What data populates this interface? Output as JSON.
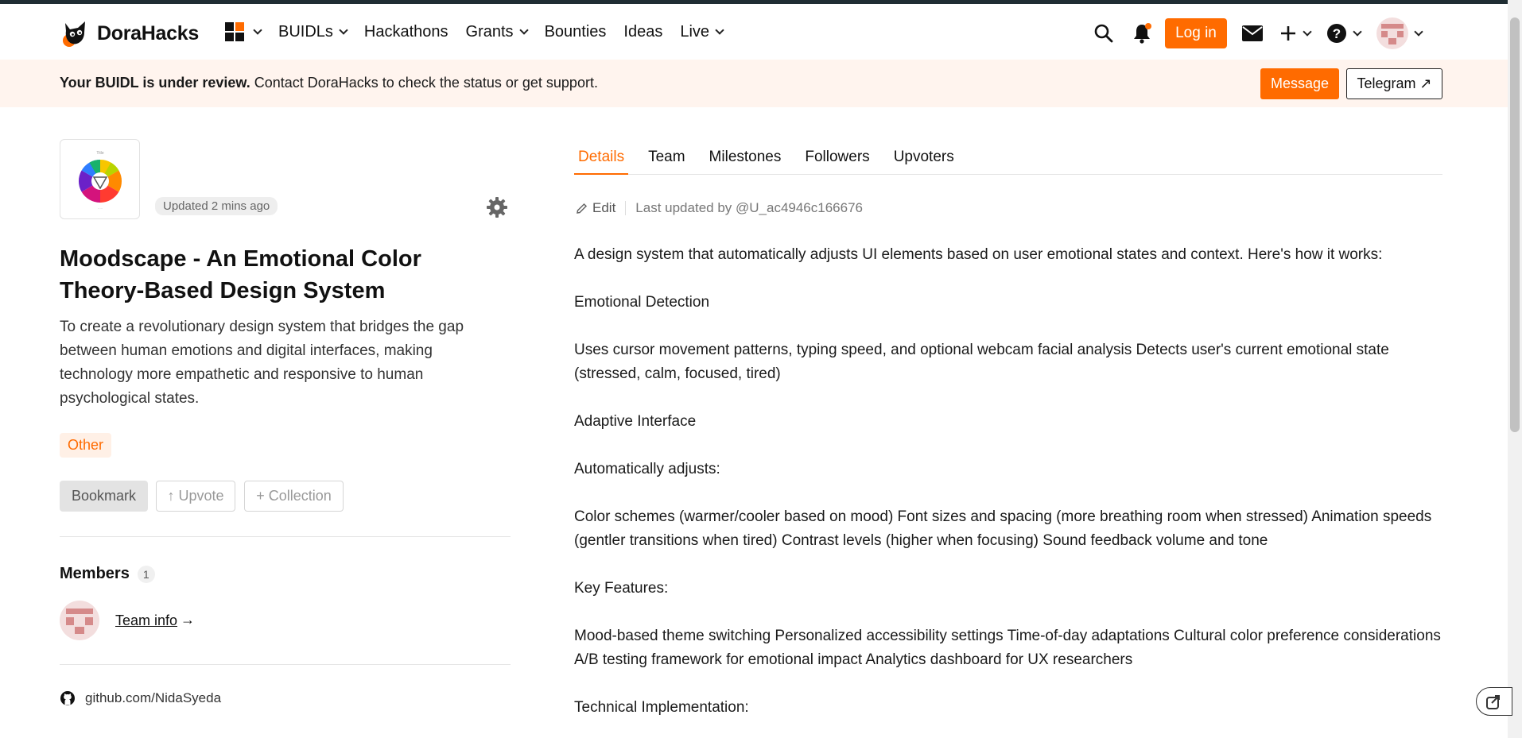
{
  "brand": {
    "name": "DoraHacks",
    "accent": "#ff6b00"
  },
  "nav": {
    "items": [
      {
        "label": "BUIDLs",
        "dropdown": true
      },
      {
        "label": "Hackathons",
        "dropdown": false
      },
      {
        "label": "Grants",
        "dropdown": true
      },
      {
        "label": "Bounties",
        "dropdown": false
      },
      {
        "label": "Ideas",
        "dropdown": false
      },
      {
        "label": "Live",
        "dropdown": true
      }
    ]
  },
  "header": {
    "login_label": "Log in"
  },
  "banner": {
    "bold": "Your BUIDL is under review.",
    "text": " Contact DoraHacks to check the status or get support.",
    "message_label": "Message",
    "telegram_label": "Telegram ↗"
  },
  "project": {
    "updated": "Updated 2 mins ago",
    "title": "Moodscape - An Emotional Color Theory-Based Design System",
    "description": "To create a revolutionary design system that bridges the gap between human emotions and digital interfaces, making technology more empathetic and responsive to human psychological states.",
    "tag": "Other",
    "actions": {
      "bookmark": "Bookmark",
      "upvote": "↑ Upvote",
      "collection": "+ Collection"
    },
    "members_title": "Members",
    "members_count": "1",
    "team_link": "Team info",
    "team_arrow": "→",
    "github": "github.com/NidaSyeda"
  },
  "tabs": [
    "Details",
    "Team",
    "Milestones",
    "Followers",
    "Upvoters"
  ],
  "details": {
    "edit_label": "Edit",
    "last_updated": "Last updated by @U_ac4946c166676",
    "paragraphs": [
      "A design system that automatically adjusts UI elements based on user emotional states and context. Here's how it works:",
      "Emotional Detection",
      "Uses cursor movement patterns, typing speed, and optional webcam facial analysis Detects user's current emotional state (stressed, calm, focused, tired)",
      "Adaptive Interface",
      "Automatically adjusts:",
      "Color schemes (warmer/cooler based on mood) Font sizes and spacing (more breathing room when stressed) Animation speeds (gentler transitions when tired) Contrast levels (higher when focusing) Sound feedback volume and tone",
      "Key Features:",
      "Mood-based theme switching Personalized accessibility settings Time-of-day adaptations Cultural color preference considerations A/B testing framework for emotional impact Analytics dashboard for UX researchers",
      "Technical Implementation:"
    ]
  }
}
